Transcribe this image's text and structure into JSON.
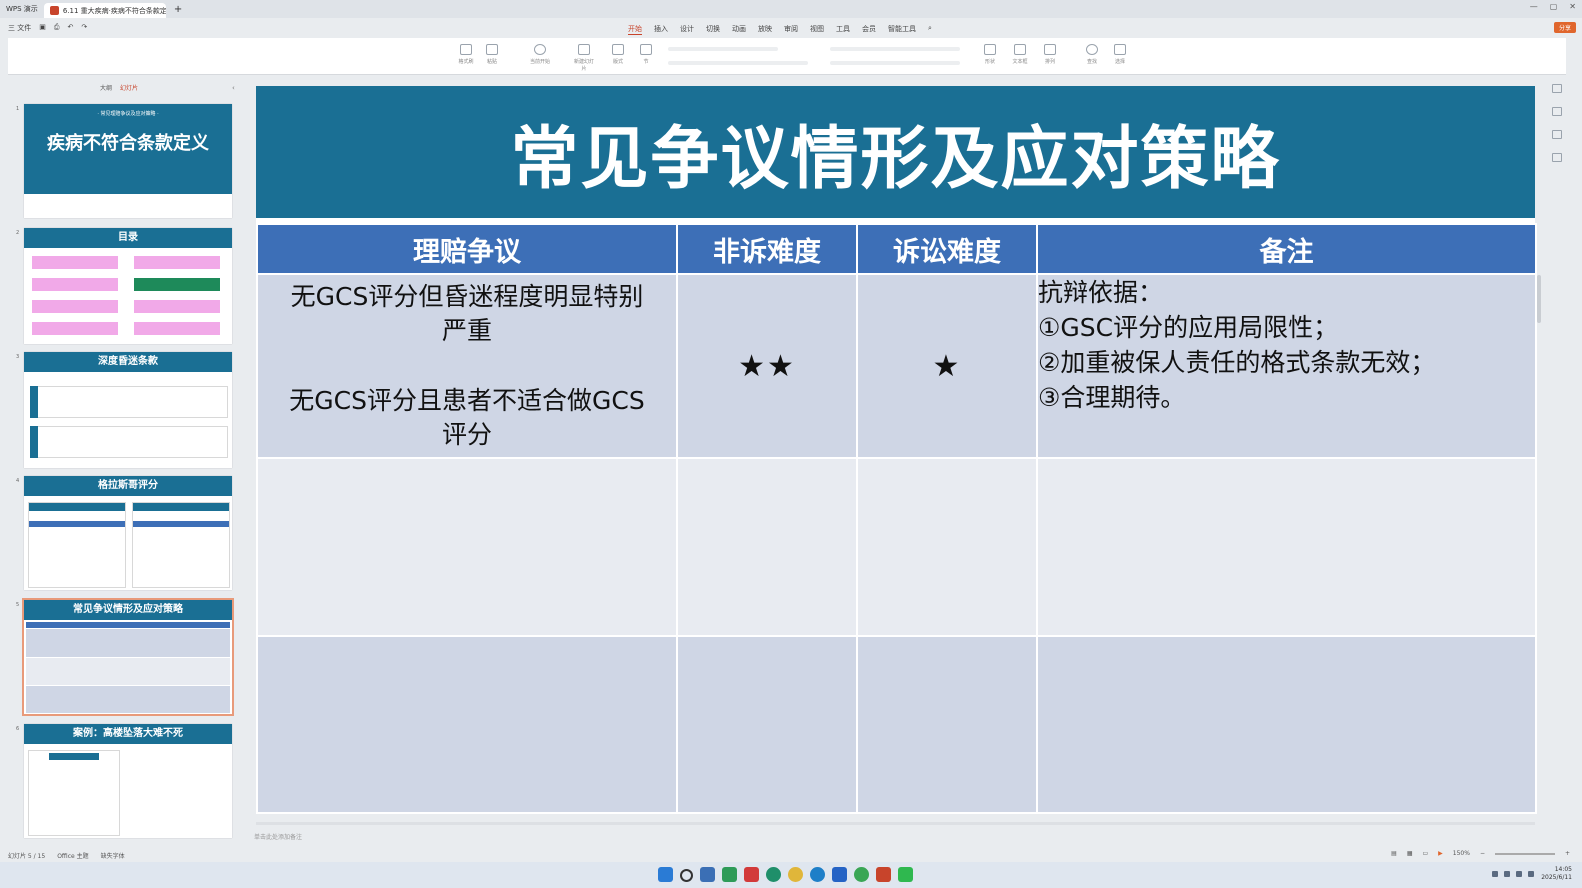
{
  "window": {
    "app_tab": "WPS 演示",
    "doc_tab": "6.11 重大疾病·疾病不符合条款定义",
    "new_tab": "+"
  },
  "menu": {
    "file": "三 文件",
    "tabs": [
      "开始",
      "插入",
      "设计",
      "切换",
      "动画",
      "放映",
      "审阅",
      "视图",
      "工具",
      "会员",
      "智能工具"
    ],
    "share": "分享"
  },
  "ribbon": {
    "groups": [
      "格式刷",
      "粘贴",
      "当前开始",
      "新建幻灯片",
      "版式",
      "节",
      "形状",
      "文本框",
      "排列",
      "查找",
      "选择"
    ]
  },
  "panel": {
    "tabs": [
      "大纲",
      "幻灯片"
    ],
    "collapse": "‹"
  },
  "thumbnails": [
    {
      "num": "1",
      "pre": "· 常见理赔争议及应对策略 ·",
      "title": "疾病不符合条款定义"
    },
    {
      "num": "2",
      "title": "目录"
    },
    {
      "num": "3",
      "title": "深度昏迷条款"
    },
    {
      "num": "4",
      "title": "格拉斯哥评分"
    },
    {
      "num": "5",
      "title": "常见争议情形及应对策略"
    },
    {
      "num": "6",
      "title": "案例：高楼坠落大难不死"
    }
  ],
  "slide": {
    "title": "常见争议情形及应对策略",
    "headers": [
      "理赔争议",
      "非诉难度",
      "诉讼难度",
      "备注"
    ],
    "row1": {
      "dispute_a": "无GCS评分但昏迷程度明显特别严重",
      "dispute_a_l1": "无GCS评分但昏迷程度明显特别",
      "dispute_a_l2": "严重",
      "dispute_b_l1": "无GCS评分且患者不适合做GCS",
      "dispute_b_l2": "评分",
      "nonlitigation": "★★",
      "litigation": "★",
      "notes": [
        "抗辩依据：",
        "①GSC评分的应用局限性；",
        "②加重被保人责任的格式条款无效；",
        "③合理期待。"
      ]
    }
  },
  "notes_placeholder": "单击此处添加备注",
  "status": {
    "slide_pos": "幻灯片 5 / 15",
    "theme": "Office 主题",
    "missing_font": "缺失字体",
    "zoom": "150%"
  },
  "taskbar": {
    "time": "14:05",
    "date": "2025/6/11"
  }
}
